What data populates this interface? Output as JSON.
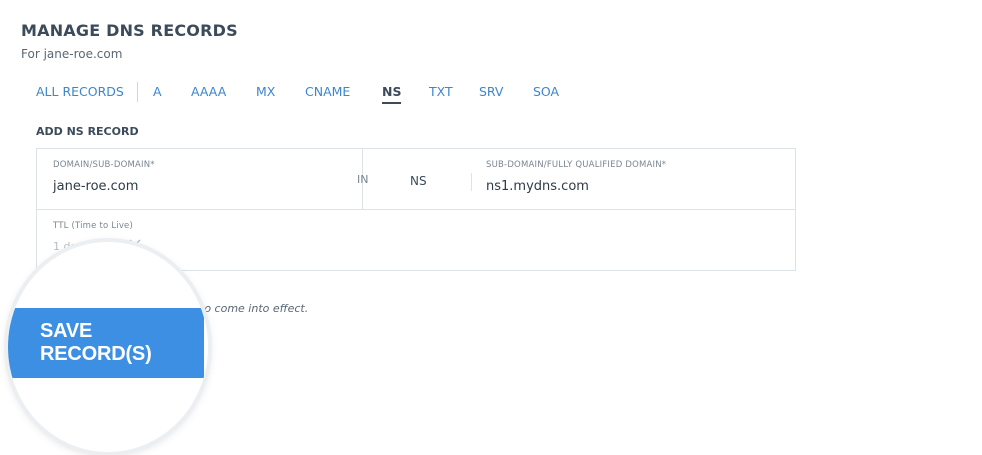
{
  "header": {
    "title": "MANAGE DNS RECORDS",
    "subtitle": "For jane-roe.com"
  },
  "tabs": [
    {
      "label": "ALL RECORDS",
      "active": false
    },
    {
      "label": "A",
      "active": false
    },
    {
      "label": "AAAA",
      "active": false
    },
    {
      "label": "MX",
      "active": false
    },
    {
      "label": "CNAME",
      "active": false
    },
    {
      "label": "NS",
      "active": true
    },
    {
      "label": "TXT",
      "active": false
    },
    {
      "label": "SRV",
      "active": false
    },
    {
      "label": "SOA",
      "active": false
    }
  ],
  "form": {
    "heading": "ADD NS RECORD",
    "domain_label": "DOMAIN/SUB-DOMAIN*",
    "domain_value": "jane-roe.com",
    "in_label": "IN",
    "type_label": "NS",
    "target_label": "SUB-DOMAIN/FULLY QUALIFIED DOMAIN*",
    "target_value": "ns1.mydns.com",
    "ttl_label": "TTL (Time to Live)",
    "ttl_value": "1 day"
  },
  "note": "to come into effect.",
  "save_button": {
    "label": "SAVE RECORD(S)"
  },
  "colors": {
    "accent": "#3d8fe3",
    "link": "#3b86d0",
    "text_dark": "#3c4b5a"
  }
}
